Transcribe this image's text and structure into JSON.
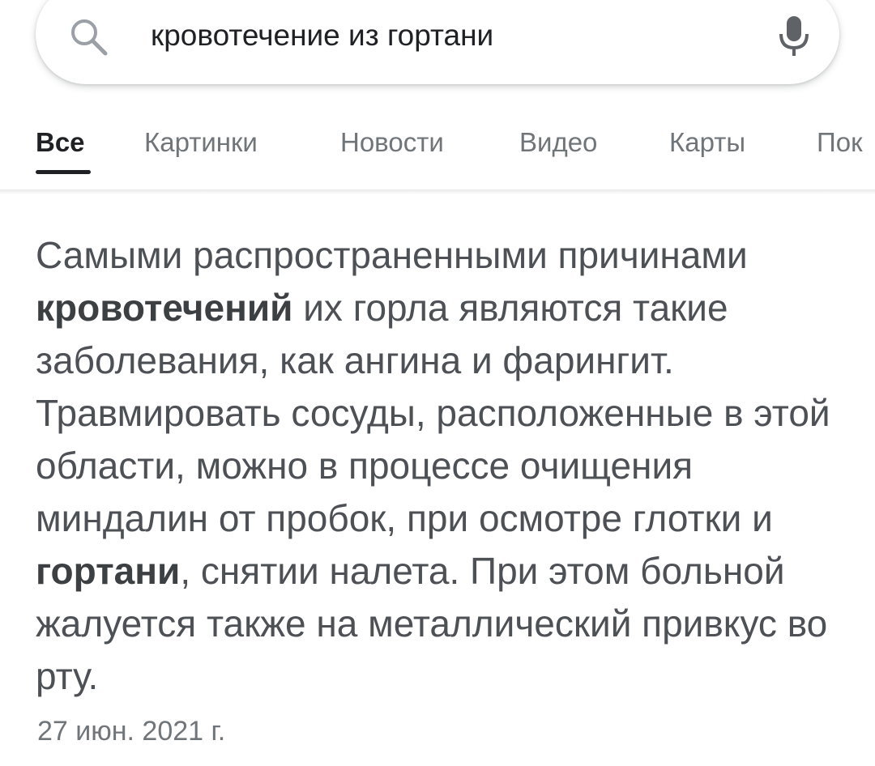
{
  "search": {
    "query": "кровотечение из гортани",
    "search_icon": "search-icon",
    "mic_icon": "mic-icon"
  },
  "tabs": [
    {
      "label": "Все",
      "active": true
    },
    {
      "label": "Картинки",
      "active": false
    },
    {
      "label": "Новости",
      "active": false
    },
    {
      "label": "Видео",
      "active": false
    },
    {
      "label": "Карты",
      "active": false
    },
    {
      "label": "Пок",
      "active": false
    }
  ],
  "snippet": {
    "text_1": "Самыми распространенными причинами ",
    "bold_1": "кровотечений",
    "text_2": " их горла являются такие заболевания, как ангина и фарингит. Травмировать сосуды, расположенные в этой области, можно в процессе очищения миндалин от пробок, при осмотре глотки и ",
    "bold_2": "гортани",
    "text_3": ", снятии налета. При этом больной жалуется также на металлический привкус во рту.",
    "date": "27 июн. 2021 г."
  },
  "colors": {
    "active_tab": "#202124",
    "inactive_tab": "#70757a",
    "snippet_text": "#4d5156"
  }
}
